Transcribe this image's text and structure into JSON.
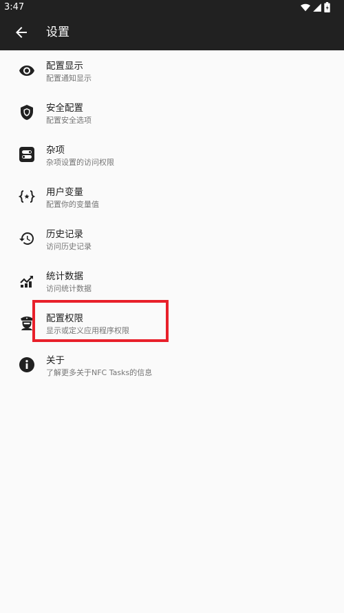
{
  "status": {
    "time": "3:47"
  },
  "appbar": {
    "title": "设置"
  },
  "items": [
    {
      "title": "配置显示",
      "sub": "配置通知显示",
      "icon": "eye-icon"
    },
    {
      "title": "安全配置",
      "sub": "配置安全选项",
      "icon": "shield-icon"
    },
    {
      "title": "杂项",
      "sub": "杂项设置的访问权限",
      "icon": "misc-toggle-icon"
    },
    {
      "title": "用户变量",
      "sub": "配置你的变量值",
      "icon": "variable-braces-icon"
    },
    {
      "title": "历史记录",
      "sub": "访问历史记录",
      "icon": "history-icon"
    },
    {
      "title": "统计数据",
      "sub": "访问统计数据",
      "icon": "stats-chart-icon"
    },
    {
      "title": "配置权限",
      "sub": "显示或定义应用程序权限",
      "icon": "police-icon"
    },
    {
      "title": "关于",
      "sub": "了解更多关于NFC Tasks的信息",
      "icon": "info-icon"
    }
  ],
  "colors": {
    "bar": "#212121",
    "background": "#fafafa",
    "highlight": "#e8202a"
  }
}
